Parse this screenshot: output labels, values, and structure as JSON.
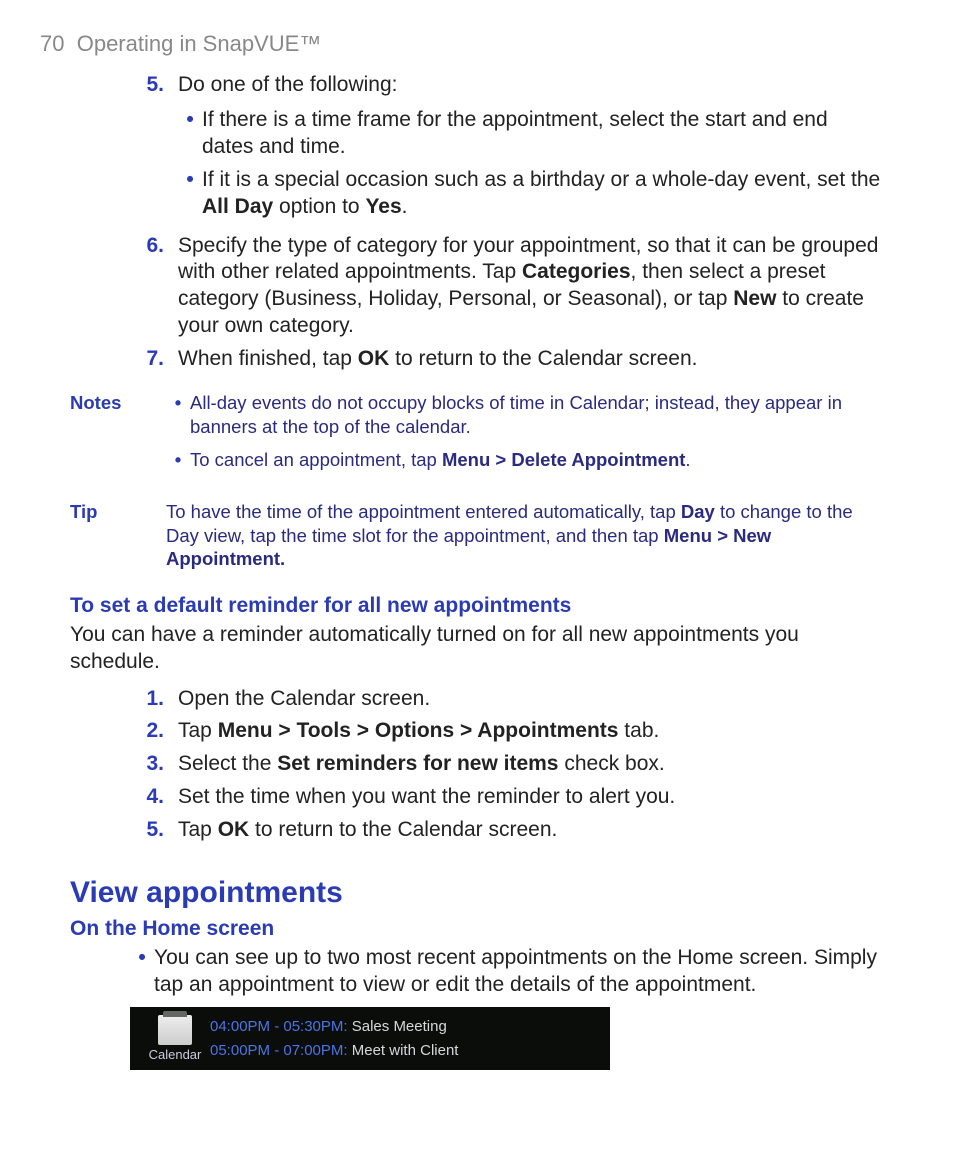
{
  "header": {
    "page_number": "70",
    "chapter": "Operating in SnapVUE™"
  },
  "steps_a": {
    "5": {
      "text": "Do one of the following:",
      "bullets": [
        {
          "pre": "If there is a time frame for the appointment, select the start and end dates and time."
        },
        {
          "pre": "If it is a special occasion such as a birthday or a whole-day event, set the ",
          "b1": "All Day",
          "mid": " option to ",
          "b2": "Yes",
          "post": "."
        }
      ]
    },
    "6": {
      "pre": "Specify the type of category for your appointment, so that it can be grouped with other related appointments. Tap ",
      "b1": "Categories",
      "mid": ", then select a preset category (Business, Holiday, Personal, or Seasonal), or tap ",
      "b2": "New",
      "post": " to create your own category."
    },
    "7": {
      "pre": "When finished, tap ",
      "b1": "OK",
      "post": " to return to the Calendar screen."
    }
  },
  "notes": {
    "label": "Notes",
    "items": [
      {
        "text": "All-day events do not occupy blocks of time in Calendar; instead, they appear in banners at the top of the calendar."
      },
      {
        "pre": "To cancel an appointment, tap ",
        "b1": "Menu > Delete Appointment",
        "post": "."
      }
    ]
  },
  "tip": {
    "label": "Tip",
    "pre": "To have the time of the appointment entered automatically, tap ",
    "b1": "Day",
    "mid": " to change to the Day view, tap the time slot for the appointment, and then tap ",
    "b2": "Menu > New Appointment.",
    "post": ""
  },
  "reminder": {
    "heading": "To set a default reminder for all new appointments",
    "intro": "You can have a reminder automatically turned on for all new appointments you schedule.",
    "steps": {
      "1": {
        "text": "Open the Calendar screen."
      },
      "2": {
        "pre": "Tap ",
        "b1": "Menu > Tools > Options > Appointments",
        "post": " tab."
      },
      "3": {
        "pre": "Select the ",
        "b1": "Set reminders for new items",
        "post": " check box."
      },
      "4": {
        "text": "Set the time when you want the reminder to alert you."
      },
      "5": {
        "pre": "Tap ",
        "b1": "OK",
        "post": " to return to the Calendar screen."
      }
    }
  },
  "view": {
    "heading": "View appointments",
    "sub1": "On the Home screen",
    "bullet": "You can see up to two most recent appointments on the Home screen. Simply tap an appointment to view or edit the details of the appointment."
  },
  "screenshot": {
    "icon_label": "Calendar",
    "rows": [
      {
        "time": "04:00PM - 05:30PM:",
        "title": "Sales Meeting"
      },
      {
        "time": "05:00PM - 07:00PM:",
        "title": "Meet with Client"
      }
    ]
  }
}
